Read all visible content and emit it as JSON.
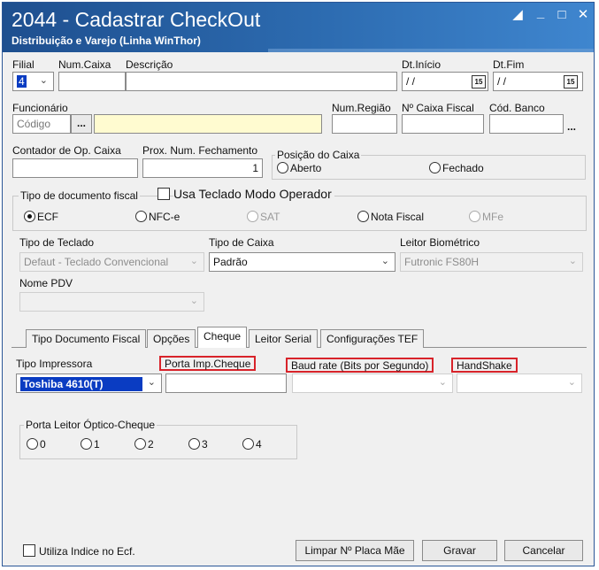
{
  "window": {
    "title": "2044 - Cadastrar CheckOut",
    "subtitle": "Distribuição e Varejo (Linha WinThor)"
  },
  "row1": {
    "filial_label": "Filial",
    "filial_value": "4",
    "num_caixa_label": "Num.Caixa",
    "descricao_label": "Descrição",
    "dt_inicio_label": "Dt.Início",
    "dt_inicio_value": "/ /",
    "dt_fim_label": "Dt.Fim",
    "dt_fim_value": "/ /",
    "calendar_text": "15"
  },
  "row2": {
    "funcionario_label": "Funcionário",
    "codigo_placeholder": "Código",
    "lookup_button": "...",
    "num_regiao_label": "Num.Região",
    "num_caixa_fiscal_label": "Nº Caixa Fiscal",
    "cod_banco_label": "Cód. Banco",
    "ellipsis": "..."
  },
  "row3": {
    "contador_label": "Contador de Op. Caixa",
    "prox_num_label": "Prox. Num. Fechamento",
    "prox_num_value": "1",
    "posicao_label": "Posição do Caixa",
    "aberto": "Aberto",
    "fechado": "Fechado"
  },
  "tipo_doc": {
    "label": "Tipo de documento fiscal",
    "teclado_modo_label": "Usa Teclado Modo Operador",
    "options": [
      "ECF",
      "NFC-e",
      "SAT",
      "Nota Fiscal",
      "MFe"
    ]
  },
  "row5": {
    "tipo_teclado_label": "Tipo de Teclado",
    "tipo_teclado_value": "Defaut - Teclado Convencional",
    "tipo_caixa_label": "Tipo de Caixa",
    "tipo_caixa_value": "Padrão",
    "leitor_label": "Leitor Biométrico",
    "leitor_value": "Futronic FS80H",
    "nome_pdv_label": "Nome PDV"
  },
  "tabs": [
    "Tipo Documento Fiscal",
    "Opções",
    "Cheque",
    "Leitor Serial",
    "Configurações TEF"
  ],
  "cheque": {
    "tipo_impressora_label": "Tipo Impressora",
    "tipo_impressora_value": "Toshiba 4610(T)",
    "porta_imp_label": "Porta Imp.Cheque",
    "baud_label": "Baud rate (Bits por Segundo)",
    "handshake_label": "HandShake",
    "porta_leitor_label": "Porta Leitor Óptico-Cheque",
    "porta_options": [
      "0",
      "1",
      "2",
      "3",
      "4"
    ]
  },
  "footer": {
    "utiliza_indice": "Utiliza Indice no Ecf.",
    "limpar": "Limpar Nº Placa Mãe",
    "gravar": "Gravar",
    "cancelar": "Cancelar"
  },
  "colors": {
    "title_bar": "#2d6cb1",
    "highlight_red": "#d8232a",
    "selection_blue": "#0a3cc2",
    "input_yellow": "#fffbd0"
  }
}
